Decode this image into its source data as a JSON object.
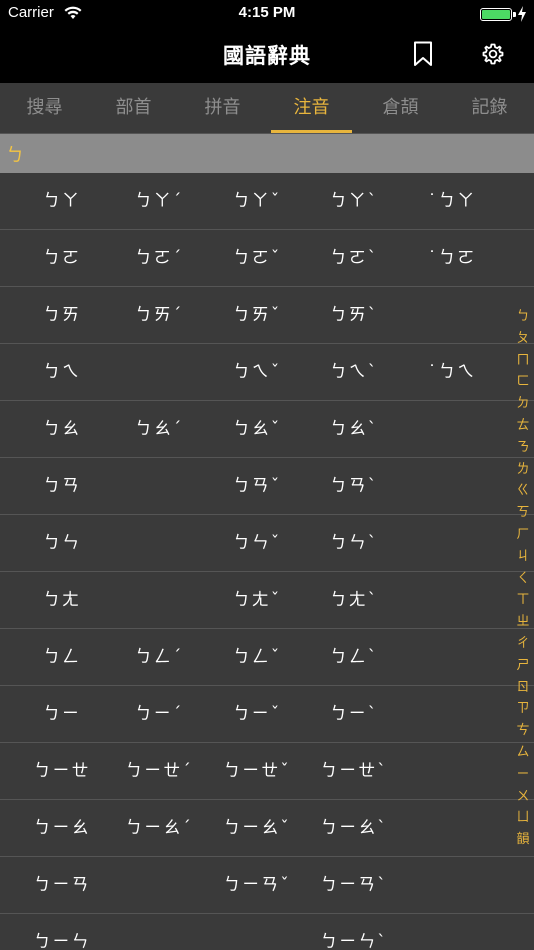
{
  "status_bar": {
    "carrier": "Carrier",
    "time": "4:15 PM",
    "battery_color": "#4cd964"
  },
  "nav": {
    "title": "國語辭典",
    "bookmark_icon": "bookmark-icon",
    "settings_icon": "gear-icon"
  },
  "tabs": [
    {
      "label": "搜尋",
      "active": false
    },
    {
      "label": "部首",
      "active": false
    },
    {
      "label": "拼音",
      "active": false
    },
    {
      "label": "注音",
      "active": true
    },
    {
      "label": "倉頡",
      "active": false
    },
    {
      "label": "記錄",
      "active": false
    }
  ],
  "accent_color": "#e8b53d",
  "section": {
    "header": "ㄅ"
  },
  "rows": [
    [
      "ㄅㄚ",
      "ㄅㄚˊ",
      "ㄅㄚˇ",
      "ㄅㄚˋ",
      "˙ㄅㄚ"
    ],
    [
      "ㄅㄛ",
      "ㄅㄛˊ",
      "ㄅㄛˇ",
      "ㄅㄛˋ",
      "˙ㄅㄛ"
    ],
    [
      "ㄅㄞ",
      "ㄅㄞˊ",
      "ㄅㄞˇ",
      "ㄅㄞˋ",
      ""
    ],
    [
      "ㄅㄟ",
      "",
      "ㄅㄟˇ",
      "ㄅㄟˋ",
      "˙ㄅㄟ"
    ],
    [
      "ㄅㄠ",
      "ㄅㄠˊ",
      "ㄅㄠˇ",
      "ㄅㄠˋ",
      ""
    ],
    [
      "ㄅㄢ",
      "",
      "ㄅㄢˇ",
      "ㄅㄢˋ",
      ""
    ],
    [
      "ㄅㄣ",
      "",
      "ㄅㄣˇ",
      "ㄅㄣˋ",
      ""
    ],
    [
      "ㄅㄤ",
      "",
      "ㄅㄤˇ",
      "ㄅㄤˋ",
      ""
    ],
    [
      "ㄅㄥ",
      "ㄅㄥˊ",
      "ㄅㄥˇ",
      "ㄅㄥˋ",
      ""
    ],
    [
      "ㄅㄧ",
      "ㄅㄧˊ",
      "ㄅㄧˇ",
      "ㄅㄧˋ",
      ""
    ],
    [
      "ㄅㄧㄝ",
      "ㄅㄧㄝˊ",
      "ㄅㄧㄝˇ",
      "ㄅㄧㄝˋ",
      ""
    ],
    [
      "ㄅㄧㄠ",
      "ㄅㄧㄠˊ",
      "ㄅㄧㄠˇ",
      "ㄅㄧㄠˋ",
      ""
    ],
    [
      "ㄅㄧㄢ",
      "",
      "ㄅㄧㄢˇ",
      "ㄅㄧㄢˋ",
      ""
    ],
    [
      "ㄅㄧㄣ",
      "",
      "",
      "ㄅㄧㄣˋ",
      ""
    ]
  ],
  "index": [
    "ㄅ",
    "ㄆ",
    "ㄇ",
    "ㄈ",
    "ㄉ",
    "ㄊ",
    "ㄋ",
    "ㄌ",
    "ㄍ",
    "ㄎ",
    "ㄏ",
    "ㄐ",
    "ㄑ",
    "ㄒ",
    "ㄓ",
    "ㄔ",
    "ㄕ",
    "ㄖ",
    "ㄗ",
    "ㄘ",
    "ㄙ",
    "ㄧ",
    "ㄨ",
    "ㄩ",
    "韻"
  ]
}
